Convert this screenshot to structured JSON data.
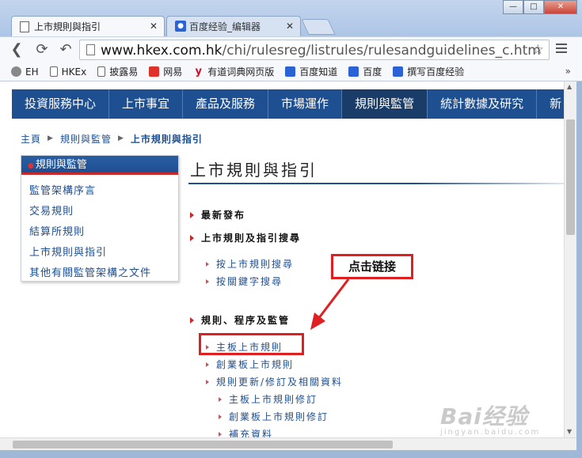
{
  "browser": {
    "tabs": [
      {
        "label": "上市規則與指引",
        "active": true
      },
      {
        "label": "百度经验_编辑器",
        "active": false
      }
    ],
    "window_buttons": {
      "minimize": "—",
      "maximize": "□",
      "close": "✕"
    },
    "url": {
      "host": "www.hkex.com.hk",
      "path": "/chi/rulesreg/listrules/rulesandguidelines_c.htm"
    },
    "bookmarks": [
      {
        "label": "EH",
        "icon": "globe-icon"
      },
      {
        "label": "HKEx",
        "icon": "page-icon"
      },
      {
        "label": "披露易",
        "icon": "page-icon"
      },
      {
        "label": "网易",
        "icon": "netease-icon"
      },
      {
        "label": "有道词典网页版",
        "icon": "youdao-icon"
      },
      {
        "label": "百度知道",
        "icon": "baidu-paw-icon"
      },
      {
        "label": "百度",
        "icon": "baidu-paw-icon"
      },
      {
        "label": "撰写百度经验",
        "icon": "baidu-paw-icon"
      }
    ],
    "bookmarks_more": "»"
  },
  "page": {
    "main_nav": [
      "投資服務中心",
      "上市事宜",
      "產品及服務",
      "市場運作",
      "規則與監管",
      "統計數據及研究",
      "新"
    ],
    "main_nav_active_index": 4,
    "breadcrumb": [
      "主頁",
      "規則與監管",
      "上市規則與指引"
    ],
    "breadcrumb_sep": "▶",
    "left_nav": {
      "header": "規則與監管",
      "items": [
        "監管架構序言",
        "交易規則",
        "結算所規則",
        "上市規則與指引",
        "其他有關監管架構之文件"
      ]
    },
    "title": "上市規則與指引",
    "sections": {
      "latest": "最新發布",
      "search": "上市規則及指引搜尋",
      "search_links": [
        "按上市規則搜尋",
        "按關鍵字搜尋"
      ],
      "rules": "規則、程序及監管",
      "rules_links": [
        "主板上市規則",
        "創業板上市規則",
        "規則更新/修訂及相關資料"
      ],
      "rules_sublinks": [
        "主板上市規則修訂",
        "創業板上市規則修訂",
        "補充資料"
      ]
    },
    "annotation": {
      "callout": "点击链接",
      "color": "#e02020"
    },
    "watermark": {
      "logo": "Bai经验",
      "sub": "jingyan.baidu.com"
    }
  },
  "colors": {
    "brand": "#1e4f91",
    "accent": "#c72828"
  }
}
